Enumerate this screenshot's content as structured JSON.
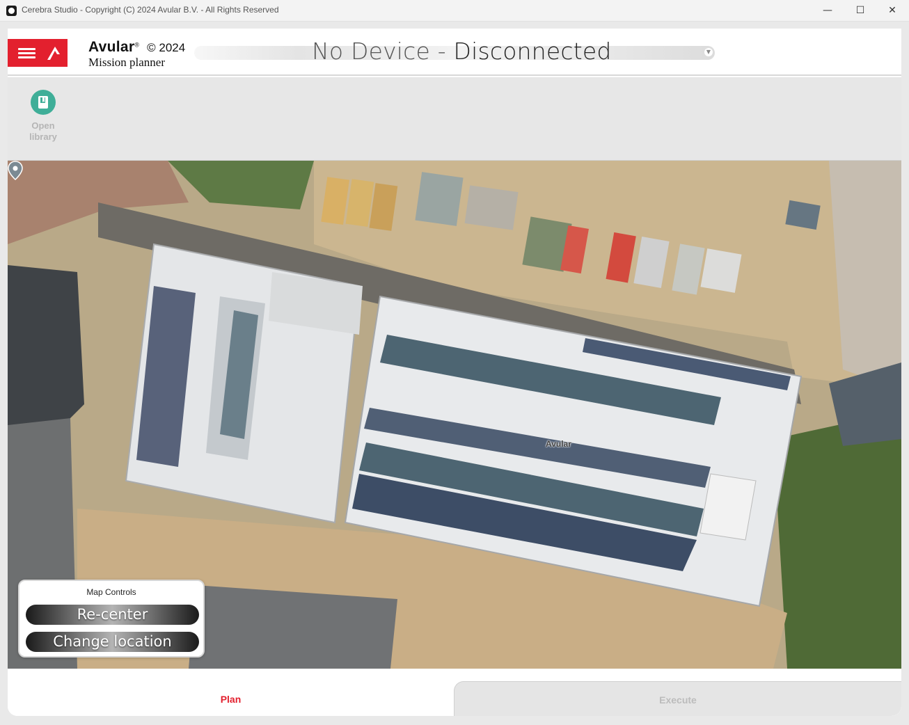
{
  "window": {
    "title": "Cerebra Studio - Copyright (C) 2024 Avular B.V. - All Rights Reserved",
    "minimize_glyph": "—",
    "maximize_glyph": "☐",
    "close_glyph": "✕"
  },
  "header": {
    "brand_name": "Avular",
    "brand_mark": "®",
    "brand_copyright": "© 2024",
    "brand_subtitle": "Mission planner",
    "device_name": "No Device",
    "device_separator": " - ",
    "device_status": "Disconnected"
  },
  "toolbar": {
    "library_label_line1": "Open",
    "library_label_line2": "library",
    "library_icon": "book-icon"
  },
  "map": {
    "pin_label": "Avular",
    "pin_icon": "map-pin-icon"
  },
  "map_controls": {
    "title": "Map Controls",
    "recenter_label": "Re-center",
    "change_location_label": "Change location"
  },
  "tabs": {
    "plan_label": "Plan",
    "execute_label": "Execute",
    "active": "Plan"
  },
  "colors": {
    "accent_red": "#e3202e",
    "library_green": "#3fae98"
  }
}
